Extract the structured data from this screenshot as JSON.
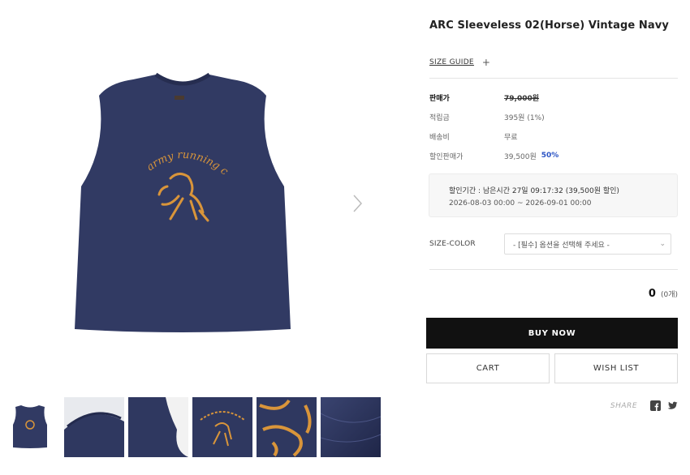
{
  "product": {
    "title": "ARC Sleeveless 02(Horse) Vintage Navy",
    "size_guide": "SIZE GUIDE",
    "main_image": "navy sleeveless shirt with orange 'army running club' horse print",
    "shirt_print_text": "army running club",
    "colors": {
      "navy": "#313a63",
      "print": "#d9953a"
    }
  },
  "thumbnails": [
    {
      "name": "front-view"
    },
    {
      "name": "collar-detail"
    },
    {
      "name": "armhole-detail"
    },
    {
      "name": "print-detail"
    },
    {
      "name": "print-closeup"
    },
    {
      "name": "fabric-texture"
    }
  ],
  "pricing": {
    "sale_price_label": "판매가",
    "sale_price": "79,000원",
    "points_label": "적립금",
    "points": "395원 (1%)",
    "shipping_label": "배송비",
    "shipping": "무료",
    "discount_price_label": "할인판매가",
    "discount_price": "39,500원",
    "discount_rate": "50%",
    "accent": "#2a53c4"
  },
  "discount_period": {
    "line1": "할인기간 :  남은시간 27일 09:17:32 (39,500원 할인)",
    "line2": "2026-08-03 00:00 ~ 2026-09-01 00:00"
  },
  "option": {
    "label": "SIZE-COLOR",
    "selected": "- [필수] 옵션을 선택해 주세요 -"
  },
  "quantity": {
    "count": "0",
    "unit": "(0개)"
  },
  "actions": {
    "buy_now": "BUY NOW",
    "cart": "CART",
    "wish_list": "WISH LIST"
  },
  "share": {
    "label": "SHARE",
    "icons": [
      "facebook-icon",
      "twitter-icon"
    ]
  }
}
